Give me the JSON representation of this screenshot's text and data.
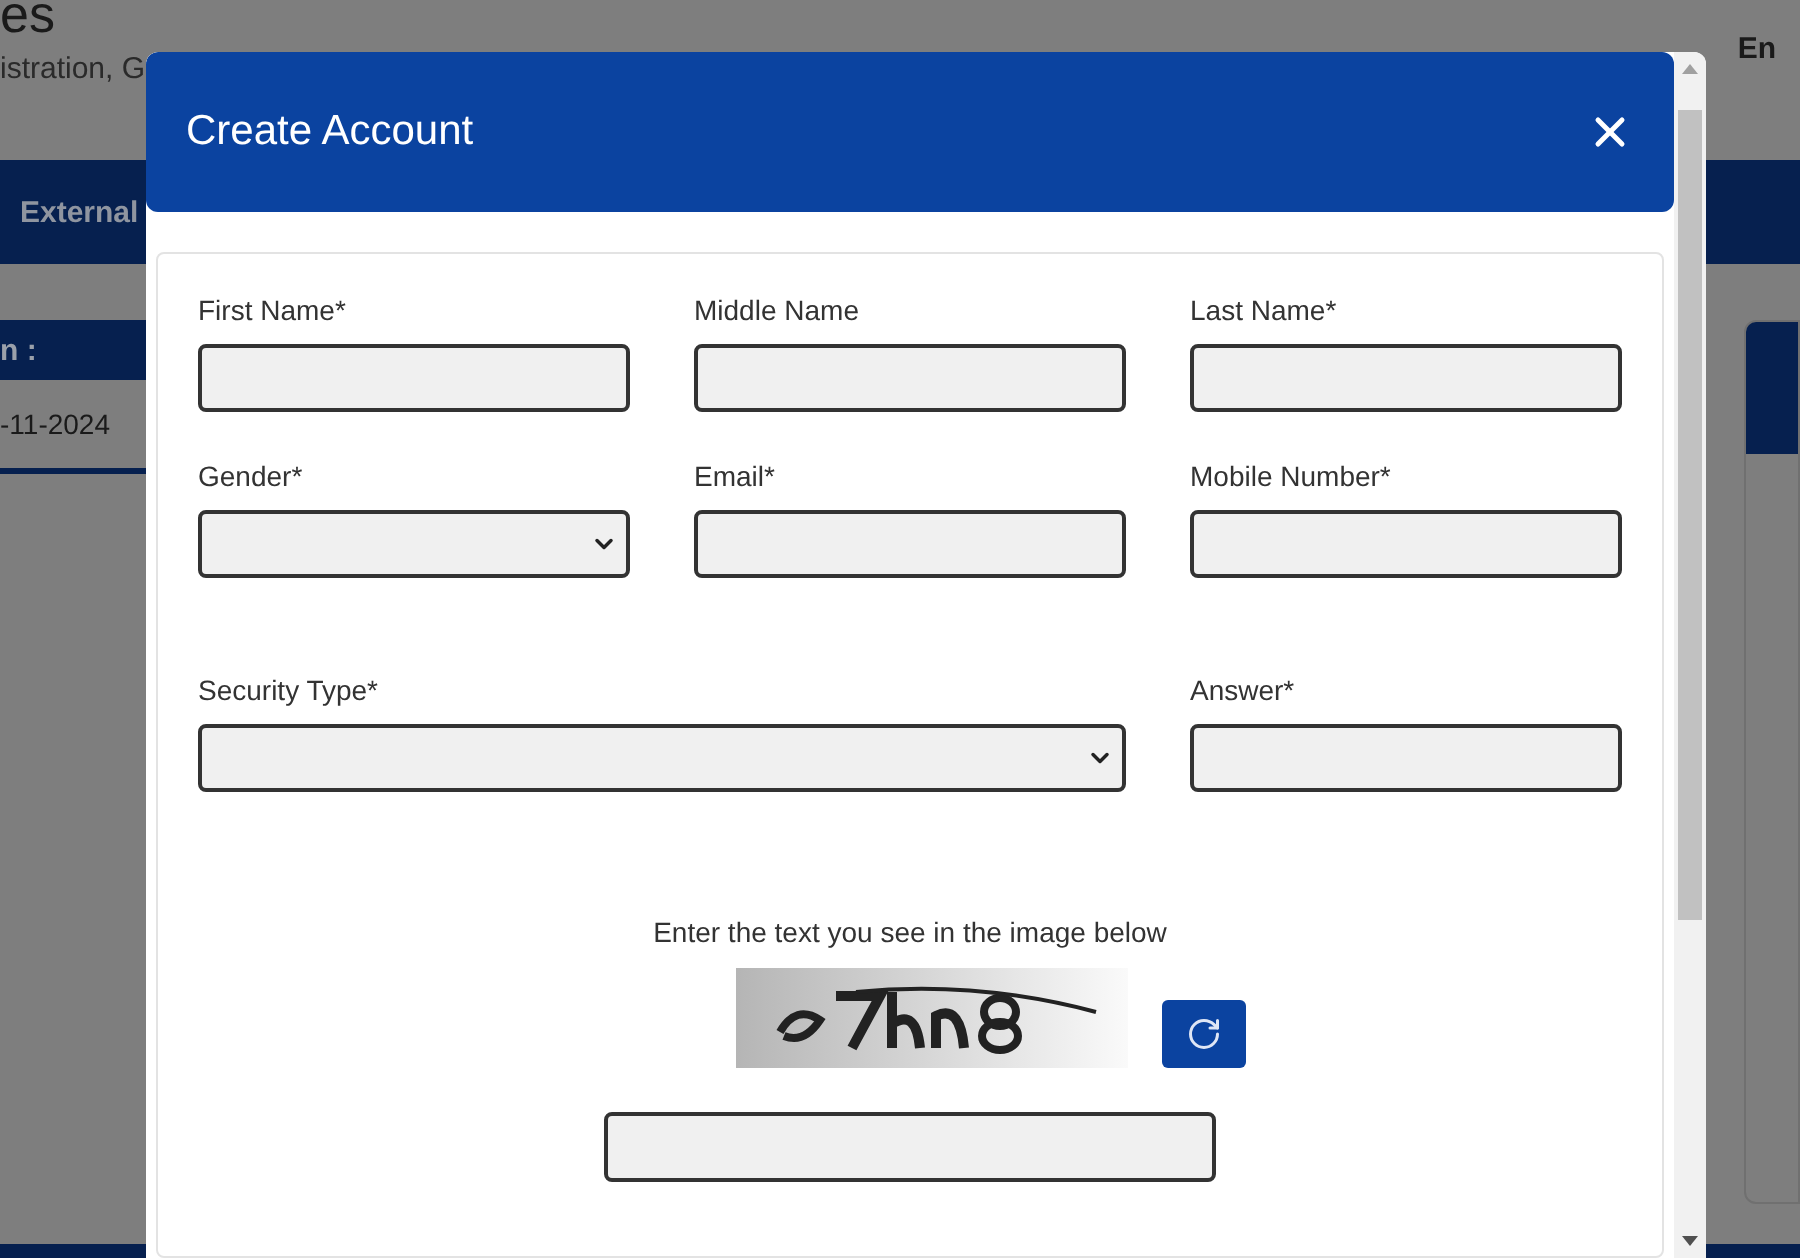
{
  "background": {
    "title": "es",
    "subtitle": "istration, G",
    "language": "En",
    "nav_item": "External",
    "panel_label": "n :",
    "date": "-11-2024"
  },
  "dialog": {
    "title": "Create Account",
    "rows": [
      {
        "fields": [
          {
            "label": "First Name*",
            "kind": "text"
          },
          {
            "label": "Middle Name",
            "kind": "text"
          },
          {
            "label": "Last Name*",
            "kind": "text"
          }
        ]
      },
      {
        "fields": [
          {
            "label": "Gender*",
            "kind": "select"
          },
          {
            "label": "Email*",
            "kind": "text"
          },
          {
            "label": "Mobile Number*",
            "kind": "text"
          }
        ]
      },
      {
        "fields": [
          {
            "label": "Security Type*",
            "kind": "wide-select"
          },
          {
            "label": "Answer*",
            "kind": "text"
          }
        ]
      }
    ],
    "captcha": {
      "prompt": "Enter the text you see in the image below"
    }
  }
}
